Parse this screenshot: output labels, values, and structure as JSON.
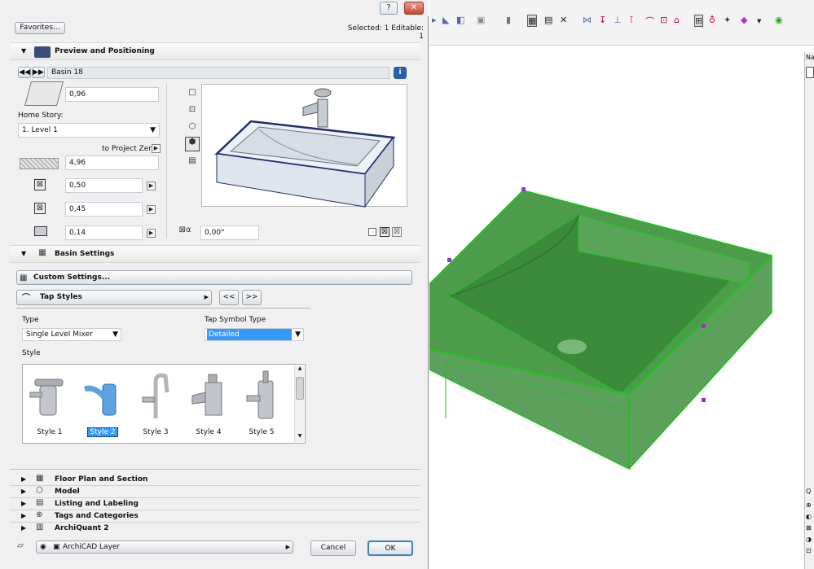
{
  "dialog": {
    "favorites_label": "Favorites...",
    "selected_status": "Selected: 1 Editable: 1",
    "window_buttons": {
      "help": "?",
      "close": "✕"
    }
  },
  "preview": {
    "section_title": "Preview and Positioning",
    "object_name": "Basin 18",
    "height_value": "0,96",
    "home_story_label": "Home Story:",
    "home_story_value": "1. Level 1",
    "to_project_zero_label": "to Project Zero",
    "elevation_value": "4,96",
    "width_value": "0,50",
    "depth_value": "0,45",
    "thickness_value": "0,14",
    "angle_value": "0,00°"
  },
  "basin_settings": {
    "section_title": "Basin Settings",
    "custom_settings_label": "Custom Settings...",
    "tap_styles_label": "Tap Styles",
    "prev_label": "<<",
    "next_label": ">>",
    "type_label": "Type",
    "type_value": "Single Level Mixer",
    "tap_symbol_type_label": "Tap Symbol Type",
    "tap_symbol_type_value": "Detailed",
    "style_label": "Style",
    "styles": [
      "Style 1",
      "Style 2",
      "Style 3",
      "Style 4",
      "Style 5"
    ],
    "selected_style": "Style 2"
  },
  "collapsed_sections": [
    "Floor Plan and Section",
    "Model",
    "Listing and Labeling",
    "Tags and Categories",
    "ArchiQuant 2"
  ],
  "footer": {
    "layer_value": "ArchiCAD Layer",
    "cancel_label": "Cancel",
    "ok_label": "OK"
  },
  "right_panel": {
    "tab_label": "Na",
    "bottom_tab_label": "Q"
  },
  "colors": {
    "selection_green": "#2e8b2e",
    "highlight_blue": "#3399ff",
    "selection_marker": "#9933cc"
  }
}
